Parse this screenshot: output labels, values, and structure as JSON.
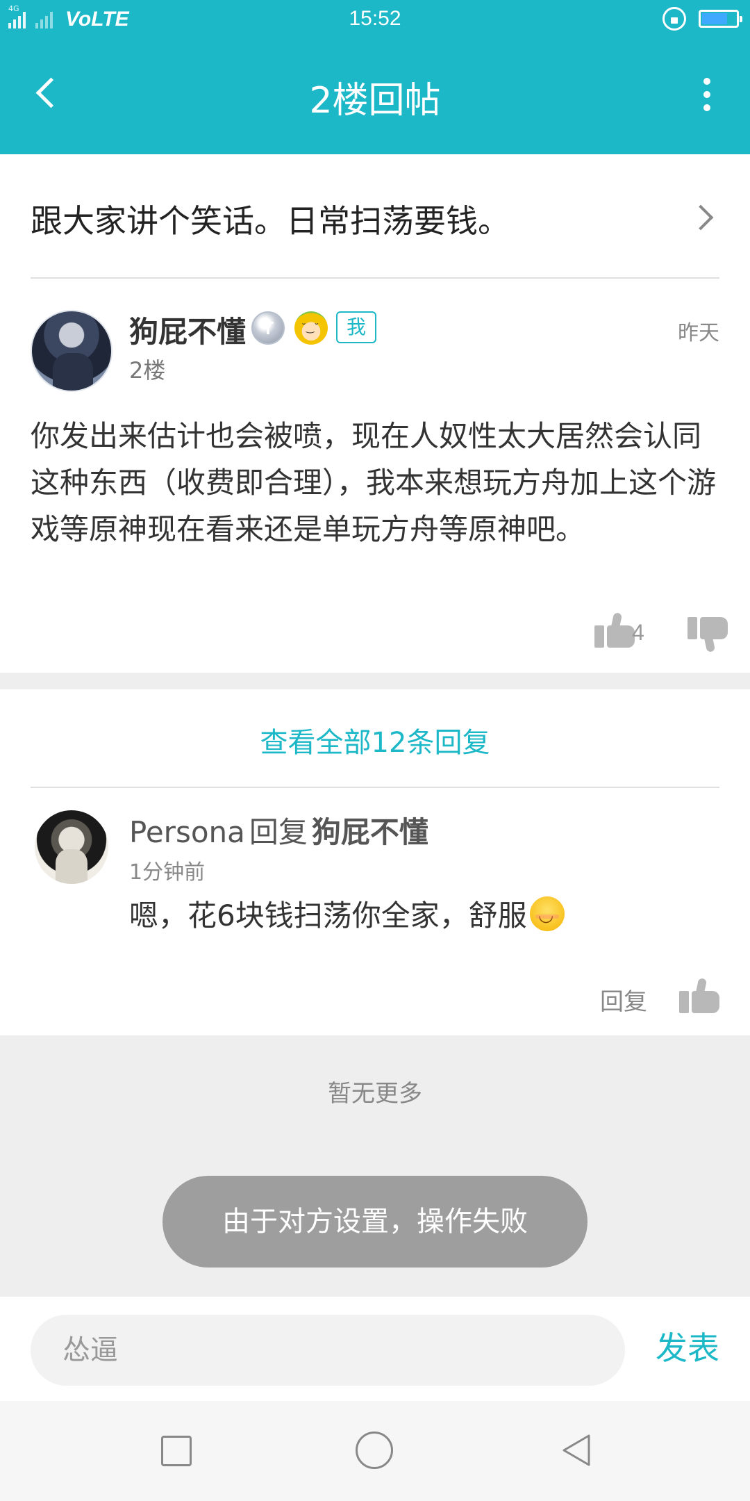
{
  "status_bar": {
    "network": "4G",
    "carrier_label": "VoLTE",
    "time": "15:52"
  },
  "app_bar": {
    "title": "2楼回帖"
  },
  "thread": {
    "title": "跟大家讲个笑话。日常扫荡要钱。"
  },
  "post": {
    "username": "狗屁不懂",
    "level_badge": "T",
    "me_badge": "我",
    "floor": "2楼",
    "time": "昨天",
    "body": "你发出来估计也会被喷，现在人奴性太大居然会认同这种东西（收费即合理），我本来想玩方舟加上这个游戏等原神现在看来还是单玩方舟等原神吧。",
    "like_count": "4"
  },
  "replies_link": "查看全部12条回复",
  "reply": {
    "username": "Persona",
    "verb": "回复",
    "target": "狗屁不懂",
    "time": "1分钟前",
    "body": "嗯，花6块钱扫荡你全家，舒服",
    "action_label": "回复"
  },
  "no_more": "暂无更多",
  "toast": "由于对方设置，操作失败",
  "composer": {
    "placeholder": "怂逼",
    "submit_label": "发表"
  },
  "colors": {
    "accent": "#1cb8c8",
    "toast_bg": "#9e9e9e",
    "section_bg": "#eeeeee"
  },
  "icons": [
    "back-arrow-icon",
    "more-vertical-icon",
    "chevron-right-icon",
    "thumbs-up-icon",
    "thumbs-down-icon",
    "smile-emoji-icon",
    "lock-rotation-icon",
    "battery-icon"
  ]
}
